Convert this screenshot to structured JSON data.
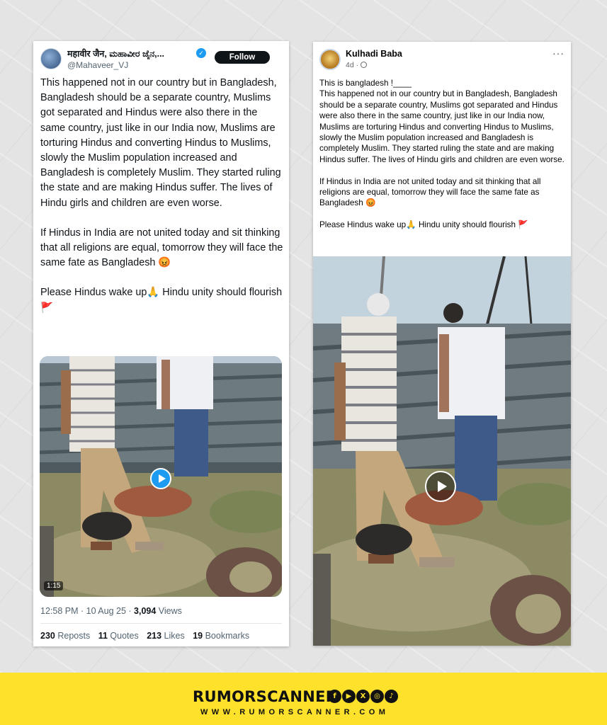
{
  "left_post": {
    "author_name": "महावीर जैन, ಮಹಾವೀರ ಜೈನ,...",
    "handle": "@Mahaveer_VJ",
    "follow_label": "Follow",
    "paragraphs": [
      "This happened not in our country but in Bangladesh, Bangladesh should be a separate country, Muslims got separated and Hindus were also there in the same country, just like in our India now, Muslims are torturing Hindus and converting Hindus to Muslims, slowly the Muslim population increased and Bangladesh is completely Muslim. They started ruling the state and are making Hindus suffer. The lives of Hindu girls and children are even worse.",
      "If Hindus in India are not united today and sit thinking that all religions are equal, tomorrow they will face the same fate as Bangladesh 😡",
      "Please Hindus wake up🙏 Hindu unity should flourish 🚩"
    ],
    "video_duration": "1:15",
    "timestamp": "12:58 PM · 10 Aug 25 · ",
    "views_count": "3,094",
    "views_label": " Views",
    "stats": [
      {
        "count": "230",
        "label": "Reposts"
      },
      {
        "count": "11",
        "label": "Quotes"
      },
      {
        "count": "213",
        "label": "Likes"
      },
      {
        "count": "19",
        "label": "Bookmarks"
      }
    ]
  },
  "right_post": {
    "author_name": "Kulhadi Baba",
    "time": "4d ·",
    "more_label": "···",
    "paragraphs": [
      "This is bangladesh !____\nThis happened not in our country but in Bangladesh, Bangladesh should be a separate country, Muslims got separated and Hindus were also there in the same country, just like in our India now, Muslims are torturing Hindus and converting Hindus to Muslims, slowly the Muslim population increased and Bangladesh is completely Muslim. They started ruling the state and are making Hindus suffer. The lives of Hindu girls and children are even worse.",
      "If Hindus in India are not united today and sit thinking that all religions are equal, tomorrow they will face the same fate as Bangladesh 😡",
      "Please Hindus wake up🙏 Hindu unity should flourish 🚩"
    ]
  },
  "footer": {
    "brand": "RUMORSCANNER",
    "website": "WWW.RUMORSCANNER.COM",
    "social_icons": [
      "facebook-icon",
      "youtube-icon",
      "x-icon",
      "instagram-icon",
      "tiktok-icon"
    ],
    "social_glyphs": [
      "f",
      "▶",
      "X",
      "◎",
      "♪"
    ],
    "background_color": "#fde12a"
  }
}
